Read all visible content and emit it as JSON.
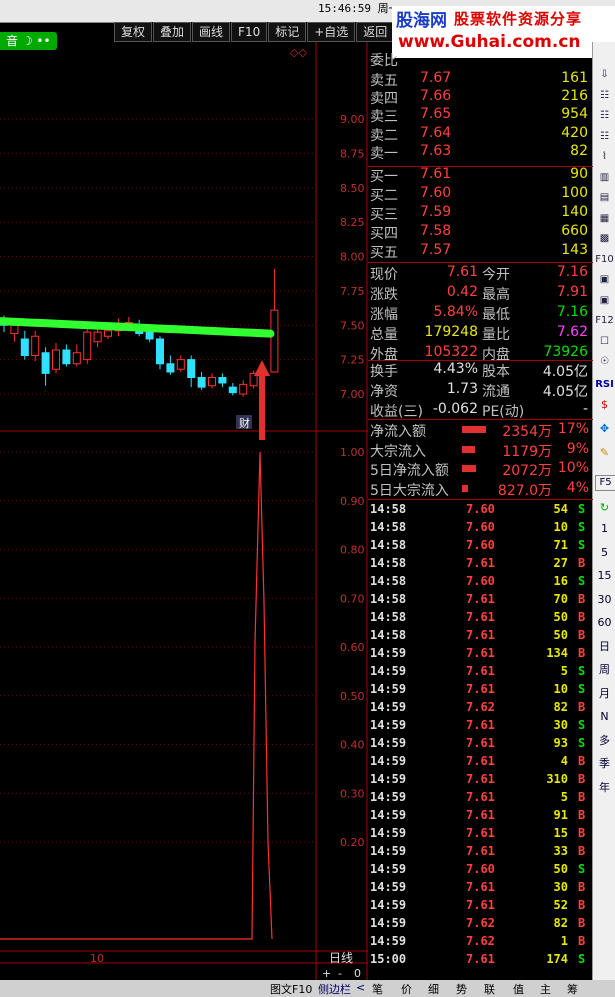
{
  "clock": "15:46:59 周一",
  "toolbar": [
    "复权",
    "叠加",
    "画线",
    "F10",
    "标记",
    "+自选",
    "返回"
  ],
  "logo": {
    "text1": "股海网",
    "text2": "股票软件资源分享",
    "text3": "www.Guhai.com.cn"
  },
  "audio_label": "音",
  "price_axis": [
    "9.00",
    "8.75",
    "8.50",
    "8.25",
    "8.00",
    "7.75",
    "7.50",
    "7.25",
    "7.00"
  ],
  "vol_axis": [
    "1.00",
    "0.90",
    "0.80",
    "0.70",
    "0.60",
    "0.50",
    "0.40",
    "0.30",
    "0.20"
  ],
  "x_label": "10",
  "period_label": "日线",
  "cai_label": "财",
  "order_book": {
    "partial_label": "委比",
    "sells": [
      {
        "label": "卖五",
        "price": "7.67",
        "vol": "161"
      },
      {
        "label": "卖四",
        "price": "7.66",
        "vol": "216"
      },
      {
        "label": "卖三",
        "price": "7.65",
        "vol": "954"
      },
      {
        "label": "卖二",
        "price": "7.64",
        "vol": "420"
      },
      {
        "label": "卖一",
        "price": "7.63",
        "vol": "82"
      }
    ],
    "buys": [
      {
        "label": "买一",
        "price": "7.61",
        "vol": "90"
      },
      {
        "label": "买二",
        "price": "7.60",
        "vol": "100"
      },
      {
        "label": "买三",
        "price": "7.59",
        "vol": "140"
      },
      {
        "label": "买四",
        "price": "7.58",
        "vol": "660"
      },
      {
        "label": "买五",
        "price": "7.57",
        "vol": "143"
      }
    ]
  },
  "quote": [
    {
      "l1": "现价",
      "v1": "7.61",
      "l2": "今开",
      "v2": "7.16"
    },
    {
      "l1": "涨跌",
      "v1": "0.42",
      "l2": "最高",
      "v2": "7.91"
    },
    {
      "l1": "涨幅",
      "v1": "5.84%",
      "l2": "最低",
      "v2": "7.16"
    },
    {
      "l1": "总量",
      "v1": "179248",
      "l2": "量比",
      "v2": "7.62"
    },
    {
      "l1": "外盘",
      "v1": "105322",
      "l2": "内盘",
      "v2": "73926"
    }
  ],
  "fundamentals": [
    {
      "l1": "换手",
      "v1": "4.43%",
      "l2": "股本",
      "v2": "4.05亿"
    },
    {
      "l1": "净资",
      "v1": "1.73",
      "l2": "流通",
      "v2": "4.05亿"
    },
    {
      "l1": "收益(三)",
      "v1": "-0.062",
      "l2": "PE(动)",
      "v2": "-"
    }
  ],
  "flows": [
    {
      "label": "净流入额",
      "amount": "2354万",
      "pct": "17%",
      "bar": 0.17
    },
    {
      "label": "大宗流入",
      "amount": "1179万",
      "pct": "9%",
      "bar": 0.09
    },
    {
      "label": "5日净流入额",
      "amount": "2072万",
      "pct": "10%",
      "bar": 0.1
    },
    {
      "label": "5日大宗流入",
      "amount": "827.0万",
      "pct": "4%",
      "bar": 0.04
    }
  ],
  "ticks": [
    [
      "14:58",
      "7.60",
      "54",
      "S"
    ],
    [
      "14:58",
      "7.60",
      "10",
      "S"
    ],
    [
      "14:58",
      "7.60",
      "71",
      "S"
    ],
    [
      "14:58",
      "7.61",
      "27",
      "B"
    ],
    [
      "14:58",
      "7.60",
      "16",
      "S"
    ],
    [
      "14:58",
      "7.61",
      "70",
      "B"
    ],
    [
      "14:58",
      "7.61",
      "50",
      "B"
    ],
    [
      "14:58",
      "7.61",
      "50",
      "B"
    ],
    [
      "14:59",
      "7.61",
      "134",
      "B"
    ],
    [
      "14:59",
      "7.61",
      "5",
      "S"
    ],
    [
      "14:59",
      "7.61",
      "10",
      "S"
    ],
    [
      "14:59",
      "7.62",
      "82",
      "B"
    ],
    [
      "14:59",
      "7.61",
      "30",
      "S"
    ],
    [
      "14:59",
      "7.61",
      "93",
      "S"
    ],
    [
      "14:59",
      "7.61",
      "4",
      "B"
    ],
    [
      "14:59",
      "7.61",
      "310",
      "B"
    ],
    [
      "14:59",
      "7.61",
      "5",
      "B"
    ],
    [
      "14:59",
      "7.61",
      "91",
      "B"
    ],
    [
      "14:59",
      "7.61",
      "15",
      "B"
    ],
    [
      "14:59",
      "7.61",
      "33",
      "B"
    ],
    [
      "14:59",
      "7.60",
      "50",
      "S"
    ],
    [
      "14:59",
      "7.61",
      "30",
      "B"
    ],
    [
      "14:59",
      "7.61",
      "52",
      "B"
    ],
    [
      "14:59",
      "7.62",
      "82",
      "B"
    ],
    [
      "14:59",
      "7.62",
      "1",
      "B"
    ],
    [
      "15:00",
      "7.61",
      "174",
      "S"
    ]
  ],
  "sidebar_items": [
    "1",
    "5",
    "15",
    "30",
    "60",
    "日",
    "周",
    "月",
    "N",
    "多",
    "季",
    "年"
  ],
  "sidebar_badge": "RSI",
  "sidebar_f5": "F5",
  "bottom_tabs": [
    "图文F10",
    "侧边栏",
    "<",
    "笔",
    "价",
    "细",
    "势",
    "联",
    "值",
    "主",
    "筹"
  ],
  "zoom": [
    "+",
    "-",
    "0"
  ],
  "candles": [
    {
      "o": 7.55,
      "c": 7.5,
      "h": 7.57,
      "l": 7.45
    },
    {
      "o": 7.44,
      "c": 7.5,
      "h": 7.53,
      "l": 7.38
    },
    {
      "o": 7.4,
      "c": 7.28,
      "h": 7.46,
      "l": 7.25
    },
    {
      "o": 7.28,
      "c": 7.42,
      "h": 7.46,
      "l": 7.24
    },
    {
      "o": 7.3,
      "c": 7.15,
      "h": 7.34,
      "l": 7.06
    },
    {
      "o": 7.18,
      "c": 7.32,
      "h": 7.37,
      "l": 7.15
    },
    {
      "o": 7.32,
      "c": 7.22,
      "h": 7.36,
      "l": 7.2
    },
    {
      "o": 7.22,
      "c": 7.3,
      "h": 7.36,
      "l": 7.2
    },
    {
      "o": 7.25,
      "c": 7.45,
      "h": 7.48,
      "l": 7.22
    },
    {
      "o": 7.38,
      "c": 7.45,
      "h": 7.48,
      "l": 7.34
    },
    {
      "o": 7.42,
      "c": 7.46,
      "h": 7.5,
      "l": 7.4
    },
    {
      "o": 7.46,
      "c": 7.5,
      "h": 7.55,
      "l": 7.42
    },
    {
      "o": 7.5,
      "c": 7.52,
      "h": 7.56,
      "l": 7.46
    },
    {
      "o": 7.5,
      "c": 7.44,
      "h": 7.54,
      "l": 7.42
    },
    {
      "o": 7.45,
      "c": 7.4,
      "h": 7.48,
      "l": 7.38
    },
    {
      "o": 7.4,
      "c": 7.22,
      "h": 7.42,
      "l": 7.18
    },
    {
      "o": 7.22,
      "c": 7.16,
      "h": 7.28,
      "l": 7.14
    },
    {
      "o": 7.18,
      "c": 7.25,
      "h": 7.28,
      "l": 7.16
    },
    {
      "o": 7.25,
      "c": 7.12,
      "h": 7.28,
      "l": 7.05
    },
    {
      "o": 7.12,
      "c": 7.05,
      "h": 7.16,
      "l": 7.03
    },
    {
      "o": 7.06,
      "c": 7.12,
      "h": 7.15,
      "l": 7.04
    },
    {
      "o": 7.12,
      "c": 7.08,
      "h": 7.15,
      "l": 7.05
    },
    {
      "o": 7.05,
      "c": 7.01,
      "h": 7.08,
      "l": 6.99
    },
    {
      "o": 7.0,
      "c": 7.07,
      "h": 7.1,
      "l": 6.98
    },
    {
      "o": 7.06,
      "c": 7.15,
      "h": 7.17,
      "l": 7.04
    },
    {
      "o": 7.16,
      "c": 7.14,
      "h": 7.18,
      "l": 7.1
    },
    {
      "o": 7.16,
      "c": 7.61,
      "h": 7.91,
      "l": 7.16
    }
  ]
}
